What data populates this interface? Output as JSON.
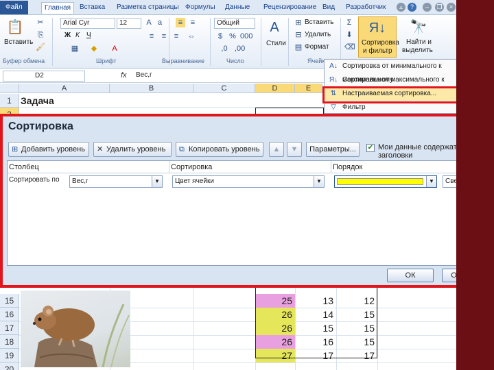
{
  "ribbon": {
    "tabs": [
      "Файл",
      "Главная",
      "Вставка",
      "Разметка страницы",
      "Формулы",
      "Данные",
      "Рецензирование",
      "Вид",
      "Разработчик"
    ],
    "groups": {
      "clipboard": {
        "label": "Буфер обмена",
        "paste": "Вставить"
      },
      "font": {
        "label": "Шрифт",
        "font_name": "Arial Cyr",
        "font_size": "12",
        "bold": "Ж",
        "italic": "К",
        "underline": "Ч"
      },
      "alignment": {
        "label": "Выравнивание"
      },
      "number": {
        "label": "Число",
        "format": "Общий"
      },
      "styles": {
        "label": "Стили",
        "styles": "Стили"
      },
      "cells": {
        "label": "Ячейки",
        "insert": "Вставить",
        "delete": "Удалить",
        "format": "Формат"
      },
      "editing": {
        "sort_filter": "Сортировка",
        "sort_filter_2": "и фильтр",
        "find": "Найти и",
        "find_2": "выделить"
      }
    }
  },
  "formula_bar": {
    "name_box": "D2",
    "fx": "fx",
    "content": "Вес,г"
  },
  "grid": {
    "columns": [
      "A",
      "B",
      "C",
      "D",
      "E"
    ],
    "top_rows": [
      "1",
      "2"
    ],
    "a1": "Задача",
    "bottom_rows": [
      {
        "n": "15",
        "d": "25",
        "e": "13",
        "f": "12",
        "color": "#e9a0e0"
      },
      {
        "n": "16",
        "d": "26",
        "e": "14",
        "f": "15",
        "color": "#e6e65a"
      },
      {
        "n": "17",
        "d": "26",
        "e": "15",
        "f": "15",
        "color": "#e6e65a"
      },
      {
        "n": "18",
        "d": "26",
        "e": "16",
        "f": "15",
        "color": "#e9a0e0"
      },
      {
        "n": "19",
        "d": "27",
        "e": "17",
        "f": "17",
        "color": "#e6e65a"
      },
      {
        "n": "20",
        "d": "",
        "e": "",
        "f": "",
        "color": ""
      }
    ]
  },
  "sort_menu": {
    "items": [
      {
        "label": "Сортировка от минимального к максимальному",
        "icon": "sort-asc-icon"
      },
      {
        "label": "Сортировка от максимального к минимальному",
        "icon": "sort-desc-icon"
      },
      {
        "label": "Настраиваемая сортировка...",
        "icon": "custom-sort-icon"
      },
      {
        "label": "Фильтр",
        "icon": "filter-icon"
      }
    ]
  },
  "dialog": {
    "title": "Сортировка",
    "help": "?",
    "close": "✕",
    "add_level": "Добавить уровень",
    "delete_level": "Удалить уровень",
    "copy_level": "Копировать уровень",
    "move_up": "▲",
    "move_down": "▼",
    "options": "Параметры...",
    "headers_checkbox": "Мои данные содержат заголовки",
    "col_column": "Столбец",
    "col_sort_on": "Сортировка",
    "col_order": "Порядок",
    "row_label": "Сортировать по",
    "column_value": "Вес,г",
    "sort_on_value": "Цвет ячейки",
    "order_color": "#ffff00",
    "position_value": "Сверху",
    "ok": "ОК",
    "cancel": "Отмена"
  },
  "colors": {
    "accent_red": "#e0161c",
    "strip": "#6b0f14",
    "highlight_yellow": "#ffff00",
    "pink": "#e9a0e0"
  }
}
